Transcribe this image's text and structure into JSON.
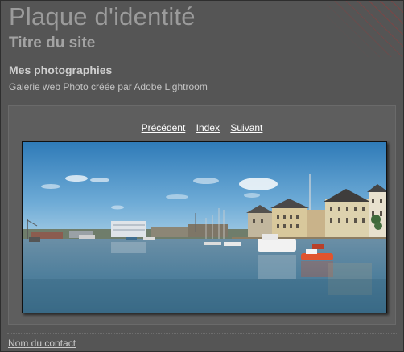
{
  "header": {
    "identity_plate": "Plaque d'identité",
    "site_title": "Titre du site"
  },
  "gallery": {
    "title": "Mes photographies",
    "description": "Galerie web Photo créée par Adobe Lightroom"
  },
  "nav": {
    "previous": "Précédent",
    "index": "Index",
    "next": "Suivant"
  },
  "footer": {
    "contact_name": "Nom du contact"
  },
  "colors": {
    "background": "#555555",
    "panel": "#5e5e5e",
    "link": "#ffffff"
  }
}
